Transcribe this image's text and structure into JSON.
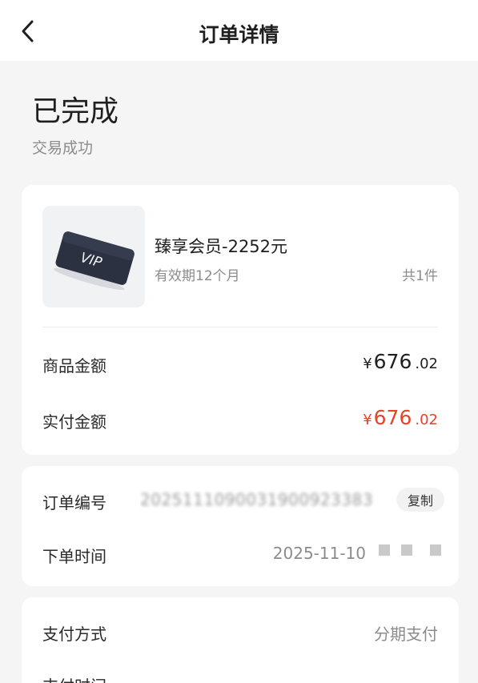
{
  "header": {
    "title": "订单详情"
  },
  "status": {
    "title": "已完成",
    "subtitle": "交易成功"
  },
  "product": {
    "name": "臻享会员-2252元",
    "validity": "有效期12个月",
    "quantity": "共1件",
    "card_text": "VIP"
  },
  "amounts": {
    "goods_label": "商品金额",
    "goods_symbol": "¥",
    "goods_int": "676",
    "goods_dec": ".02",
    "paid_label": "实付金额",
    "paid_symbol": "¥",
    "paid_int": "676",
    "paid_dec": ".02"
  },
  "order": {
    "number_label": "订单编号",
    "number_value": "2025111090031900923383",
    "copy_label": "复制",
    "time_label": "下单时间",
    "time_value": "2025-11-10"
  },
  "payment": {
    "method_label": "支付方式",
    "method_value": "分期支付",
    "time_label": "支付时间"
  },
  "colors": {
    "accent_red": "#e6432a",
    "background": "#f5f5f6",
    "secondary_text": "#8c8c8c"
  },
  "icons": {
    "back": "chevron-left-icon"
  }
}
